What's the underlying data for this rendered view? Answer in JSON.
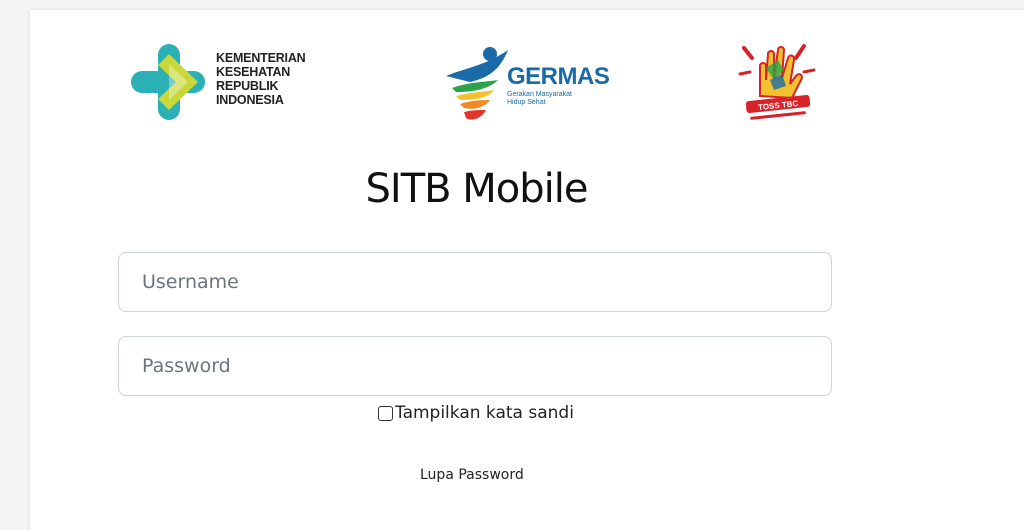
{
  "logos": {
    "kemenkes": {
      "lines": [
        "KEMENTERIAN",
        "KESEHATAN",
        "REPUBLIK",
        "INDONESIA"
      ],
      "colors": [
        "#2bb0b5",
        "#c8d83a"
      ]
    },
    "germas": {
      "word": "GERMAS",
      "tagline": [
        "Gerakan Masyarakat",
        "Hidup Sehat"
      ],
      "color": "#1a6aa8"
    },
    "toss_tbc": {
      "text": "TOSS TBC",
      "color": "#d6232a"
    }
  },
  "title": "SITB Mobile",
  "form": {
    "username_placeholder": "Username",
    "password_placeholder": "Password",
    "show_password_label": "Tampilkan kata sandi",
    "forgot_password_label": "Lupa Password"
  }
}
